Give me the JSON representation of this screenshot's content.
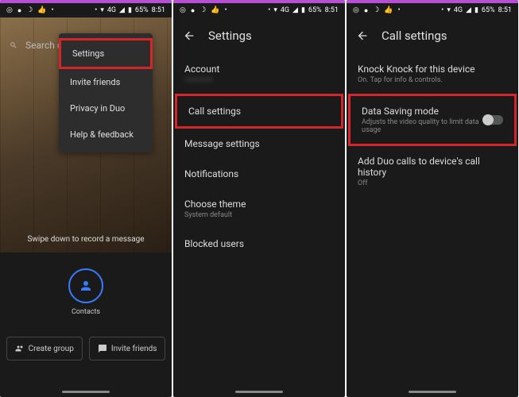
{
  "status": {
    "signal": "4G",
    "battery": "65%",
    "time": "8:51"
  },
  "phone1": {
    "search_placeholder": "Search co",
    "menu": {
      "settings": "Settings",
      "invite": "Invite friends",
      "privacy": "Privacy in Duo",
      "help": "Help & feedback"
    },
    "swipe_hint": "Swipe down to record a message",
    "contacts_label": "Contacts",
    "create_group": "Create group",
    "invite_friends": "Invite friends"
  },
  "phone2": {
    "title": "Settings",
    "items": {
      "account": "Account",
      "account_sub": "redacted",
      "call": "Call settings",
      "message": "Message settings",
      "notifications": "Notifications",
      "theme": "Choose theme",
      "theme_sub": "System default",
      "blocked": "Blocked users"
    }
  },
  "phone3": {
    "title": "Call settings",
    "knock": {
      "title": "Knock Knock for this device",
      "sub": "On. Tap for info & controls."
    },
    "data_saving": {
      "title": "Data Saving mode",
      "sub": "Adjusts the video quality to limit data usage"
    },
    "history": {
      "title": "Add Duo calls to device's call history",
      "sub": "Off"
    }
  }
}
